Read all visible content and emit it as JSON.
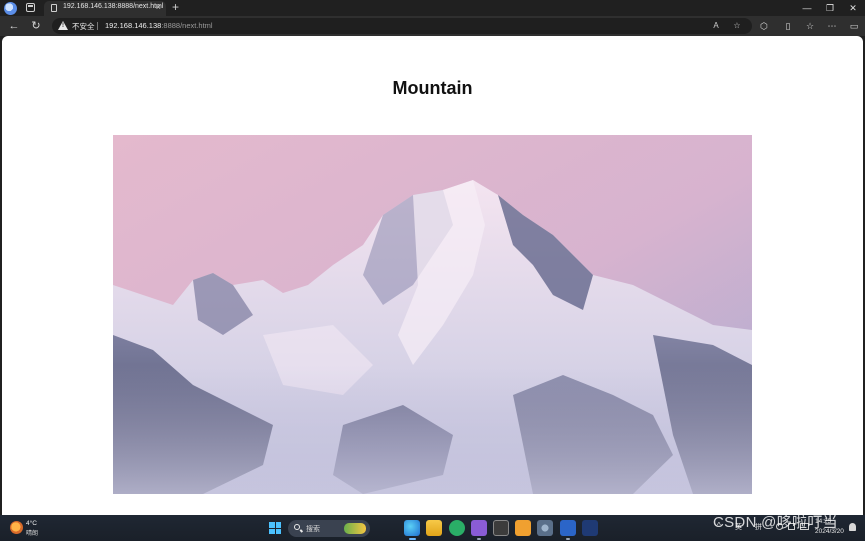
{
  "browser": {
    "tab": {
      "title": "192.168.146.138:8888/next.html",
      "close_glyph": "×"
    },
    "new_tab_glyph": "+",
    "window_controls": {
      "minimize": "—",
      "maximize": "❐",
      "close": "✕"
    },
    "address": {
      "security_label": "不安全",
      "url_host": "192.168.146.138",
      "url_rest": ":8888/next.html"
    },
    "nav": {
      "back_glyph": "←",
      "reload_glyph": "↻"
    }
  },
  "page": {
    "heading": "Mountain",
    "image": {
      "alt": "Mountain",
      "subject": "snow-covered mountain peak at dusk under a pink sky"
    }
  },
  "taskbar": {
    "weather": {
      "temperature": "4°C",
      "condition": "晴朗"
    },
    "search": {
      "placeholder": "搜索"
    },
    "apps": [
      "edge",
      "file-explorer",
      "wechat",
      "visual-studio",
      "terminal",
      "app-box",
      "settings",
      "word",
      "vs-code"
    ],
    "tray": {
      "up_glyph": "^",
      "lang_1": "英",
      "lang_2": "拼"
    },
    "clock": {
      "time": "14:25",
      "date": "2024/3/20"
    }
  },
  "watermark": "CSDN @哆啦叮当",
  "colors": {
    "browser_chrome": "#202020",
    "taskbar": "#1f2733",
    "accent": "#4cc2ff"
  }
}
